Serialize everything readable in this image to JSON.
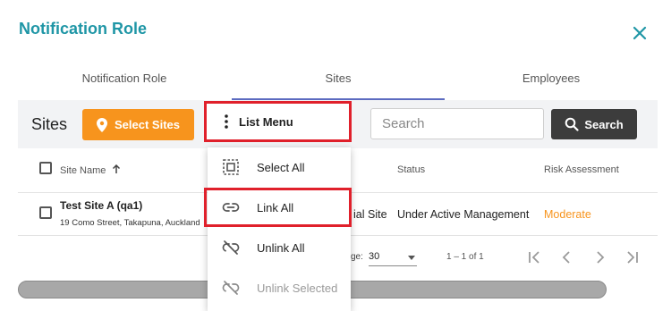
{
  "dialog": {
    "title": "Notification Role"
  },
  "tabs": [
    {
      "label": "Notification Role"
    },
    {
      "label": "Sites"
    },
    {
      "label": "Employees"
    }
  ],
  "toolbar": {
    "sites_label": "Sites",
    "select_sites_label": "Select Sites",
    "list_menu_label": "List Menu",
    "search_placeholder": "Search",
    "search_button_label": "Search"
  },
  "table": {
    "columns": [
      "Site Name",
      "Status",
      "Risk Assessment"
    ],
    "rows": [
      {
        "name": "Test Site A (qa1)",
        "address": "19 Como Street, Takapuna, Auckland",
        "type_fragment": "ial Site",
        "status": "Under Active Management",
        "risk": "Moderate"
      }
    ]
  },
  "pagination": {
    "label_fragment": "ge:",
    "page_size": "30",
    "range": "1 – 1 of 1"
  },
  "menu": {
    "items": [
      {
        "label": "Select All",
        "icon": "select-all-icon",
        "enabled": true
      },
      {
        "label": "Link All",
        "icon": "link-icon",
        "enabled": true
      },
      {
        "label": "Unlink All",
        "icon": "link-off-icon",
        "enabled": true
      },
      {
        "label": "Unlink Selected",
        "icon": "link-off-icon",
        "enabled": false
      }
    ]
  },
  "colors": {
    "title": "#1f96a6",
    "select_sites_button": "#f7941d",
    "search_button": "#3c3c3c",
    "highlight": "#e0202b",
    "tab_indicator": "#5c6bc0",
    "risk_moderate": "#f7941d"
  }
}
